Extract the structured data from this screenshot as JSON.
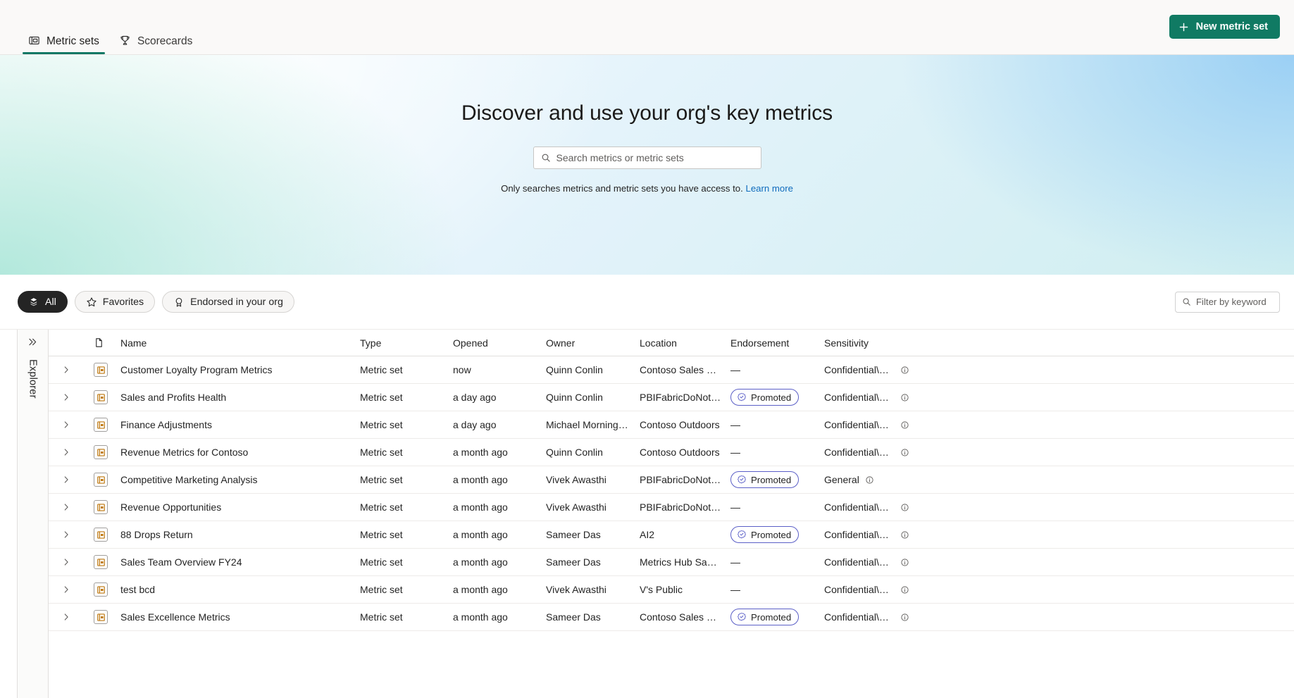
{
  "header": {
    "tabs": [
      {
        "label": "Metric sets",
        "icon": "metric-set-icon",
        "active": true
      },
      {
        "label": "Scorecards",
        "icon": "trophy-icon",
        "active": false
      }
    ],
    "new_button": {
      "label": "New metric set",
      "icon": "plus-icon"
    },
    "accent_color": "#107a63"
  },
  "hero": {
    "title": "Discover and use your org's key metrics",
    "search": {
      "placeholder": "Search metrics or metric sets",
      "value": "",
      "icon": "search-icon"
    },
    "note_text": "Only searches metrics and metric sets you have access to.",
    "note_link": "Learn more",
    "link_color": "#0f6cbd"
  },
  "filters": {
    "pills": [
      {
        "label": "All",
        "icon": "stack-icon",
        "selected": true
      },
      {
        "label": "Favorites",
        "icon": "star-icon",
        "selected": false
      },
      {
        "label": "Endorsed in your org",
        "icon": "endorsement-badge-icon",
        "selected": false
      }
    ],
    "keyword": {
      "placeholder": "Filter by keyword",
      "value": "",
      "icon": "search-icon"
    }
  },
  "explorer": {
    "label": "Explorer",
    "expand_icon": "double-chevron-right-icon"
  },
  "table": {
    "columns": [
      "",
      "",
      "Name",
      "Type",
      "Opened",
      "Owner",
      "Location",
      "Endorsement",
      "Sensitivity"
    ],
    "header_file_icon": "file-icon",
    "row_icon": "metric-set-item-icon",
    "expand_icon": "chevron-right-icon",
    "info_icon": "info-icon",
    "endorsement_icon": "badge-check-icon",
    "rows": [
      {
        "name": "Customer Loyalty Program Metrics",
        "type": "Metric set",
        "opened": "now",
        "owner": "Quinn Conlin",
        "location": "Contoso Sales Dem...",
        "endorsement": "—",
        "endorsed": false,
        "sensitivity": "Confidential\\Mi..."
      },
      {
        "name": "Sales and Profits Health",
        "type": "Metric set",
        "opened": "a day ago",
        "owner": "Quinn Conlin",
        "location": "PBIFabricDoNotDelete",
        "endorsement": "Promoted",
        "endorsed": true,
        "sensitivity": "Confidential\\Mi..."
      },
      {
        "name": "Finance Adjustments",
        "type": "Metric set",
        "opened": "a day ago",
        "owner": "Michael Morningstar",
        "location": "Contoso Outdoors",
        "endorsement": "—",
        "endorsed": false,
        "sensitivity": "Confidential\\Mi..."
      },
      {
        "name": "Revenue Metrics for Contoso",
        "type": "Metric set",
        "opened": "a month ago",
        "owner": "Quinn Conlin",
        "location": "Contoso Outdoors",
        "endorsement": "—",
        "endorsed": false,
        "sensitivity": "Confidential\\Mi..."
      },
      {
        "name": "Competitive Marketing Analysis",
        "type": "Metric set",
        "opened": "a month ago",
        "owner": "Vivek Awasthi",
        "location": "PBIFabricDoNotDelete",
        "endorsement": "Promoted",
        "endorsed": true,
        "sensitivity": "General"
      },
      {
        "name": "Revenue Opportunities",
        "type": "Metric set",
        "opened": "a month ago",
        "owner": "Vivek Awasthi",
        "location": "PBIFabricDoNotDelete",
        "endorsement": "—",
        "endorsed": false,
        "sensitivity": "Confidential\\Mi..."
      },
      {
        "name": "88 Drops Return",
        "type": "Metric set",
        "opened": "a month ago",
        "owner": "Sameer Das",
        "location": "AI2",
        "endorsement": "Promoted",
        "endorsed": true,
        "sensitivity": "Confidential\\Mi..."
      },
      {
        "name": "Sales Team Overview FY24",
        "type": "Metric set",
        "opened": "a month ago",
        "owner": "Sameer Das",
        "location": "Metrics Hub Samples",
        "endorsement": "—",
        "endorsed": false,
        "sensitivity": "Confidential\\Mi..."
      },
      {
        "name": "test bcd",
        "type": "Metric set",
        "opened": "a month ago",
        "owner": "Vivek Awasthi",
        "location": "V's Public",
        "endorsement": "—",
        "endorsed": false,
        "sensitivity": "Confidential\\Mi..."
      },
      {
        "name": "Sales Excellence Metrics",
        "type": "Metric set",
        "opened": "a month ago",
        "owner": "Sameer Das",
        "location": "Contoso Sales Dem...",
        "endorsement": "Promoted",
        "endorsed": true,
        "sensitivity": "Confidential\\Mi..."
      }
    ]
  }
}
